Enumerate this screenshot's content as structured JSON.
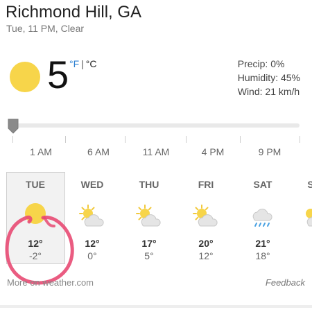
{
  "location": "Richmond Hill, GA",
  "subtitle": "Tue, 11 PM, Clear",
  "current": {
    "temp": "5",
    "unit_f": "°F",
    "unit_sep": "|",
    "unit_c": "°C",
    "icon": "sun-icon"
  },
  "stats": {
    "precip": "Precip: 0%",
    "humidity": "Humidity: 45%",
    "wind": "Wind: 21 km/h"
  },
  "timeline": {
    "hours": [
      "1 AM",
      "6 AM",
      "11 AM",
      "4 PM",
      "9 PM"
    ]
  },
  "days": [
    {
      "name": "TUE",
      "hi": "12°",
      "lo": "-2°",
      "icon": "sun-icon"
    },
    {
      "name": "WED",
      "hi": "12°",
      "lo": "0°",
      "icon": "partly-cloudy-icon"
    },
    {
      "name": "THU",
      "hi": "17°",
      "lo": "5°",
      "icon": "partly-cloudy-icon"
    },
    {
      "name": "FRI",
      "hi": "20°",
      "lo": "12°",
      "icon": "partly-cloudy-icon"
    },
    {
      "name": "SAT",
      "hi": "21°",
      "lo": "18°",
      "icon": "rain-icon"
    },
    {
      "name": "S",
      "hi": "",
      "lo": "",
      "icon": "partly-cloudy-icon"
    }
  ],
  "footer": {
    "more": "More on weather.com",
    "feedback": "Feedback"
  },
  "colors": {
    "sun": "#f7d54a",
    "unit_active": "#2b7fd0",
    "annotation": "#e84a73"
  }
}
